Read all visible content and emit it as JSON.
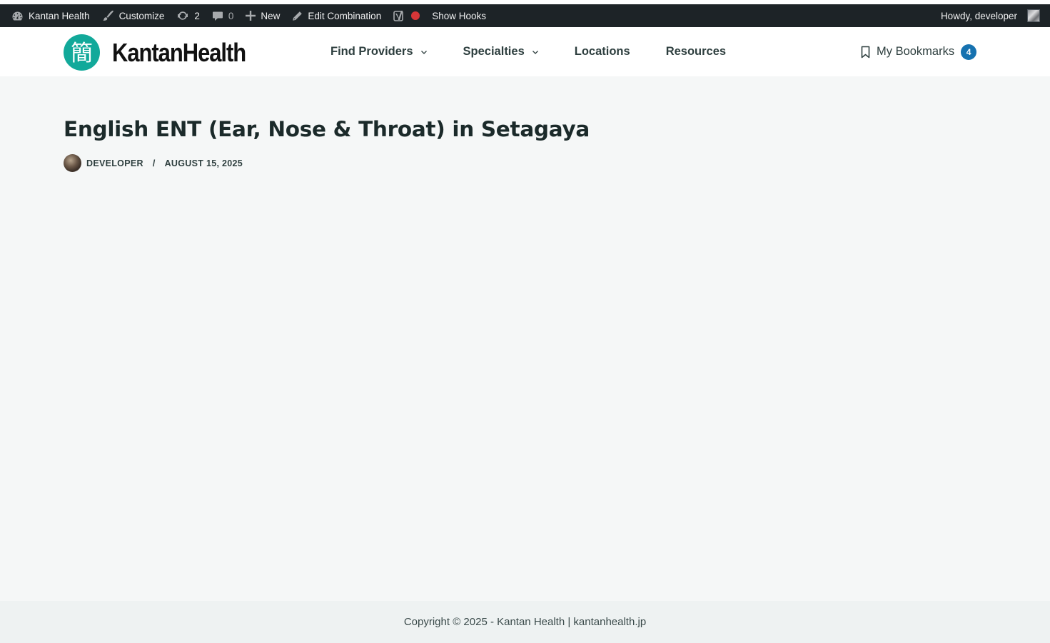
{
  "adminbar": {
    "site_name": "Kantan Health",
    "customize": "Customize",
    "updates_count": "2",
    "comments_count": "0",
    "new_label": "New",
    "edit_label": "Edit Combination",
    "hooks_label": "Show Hooks",
    "howdy": "Howdy, developer"
  },
  "header": {
    "logo_text": "KantanHealth",
    "logo_glyph": "簡",
    "nav": [
      {
        "label": "Find Providers",
        "dropdown": true
      },
      {
        "label": "Specialties",
        "dropdown": true
      },
      {
        "label": "Locations",
        "dropdown": false
      },
      {
        "label": "Resources",
        "dropdown": false
      }
    ],
    "bookmarks_label": "My Bookmarks",
    "bookmarks_count": "4"
  },
  "post": {
    "title": "English ENT (Ear, Nose & Throat) in Setagaya",
    "author": "DEVELOPER",
    "separator": "/",
    "date": "AUGUST 15, 2025"
  },
  "footer": {
    "copyright": "Copyright © 2025 - Kantan Health | kantanhealth.jp"
  },
  "colors": {
    "brand_teal": "#12a99a",
    "badge_blue": "#1672b0",
    "adminbar_bg": "#1d2327",
    "recording_red": "#d63638"
  }
}
